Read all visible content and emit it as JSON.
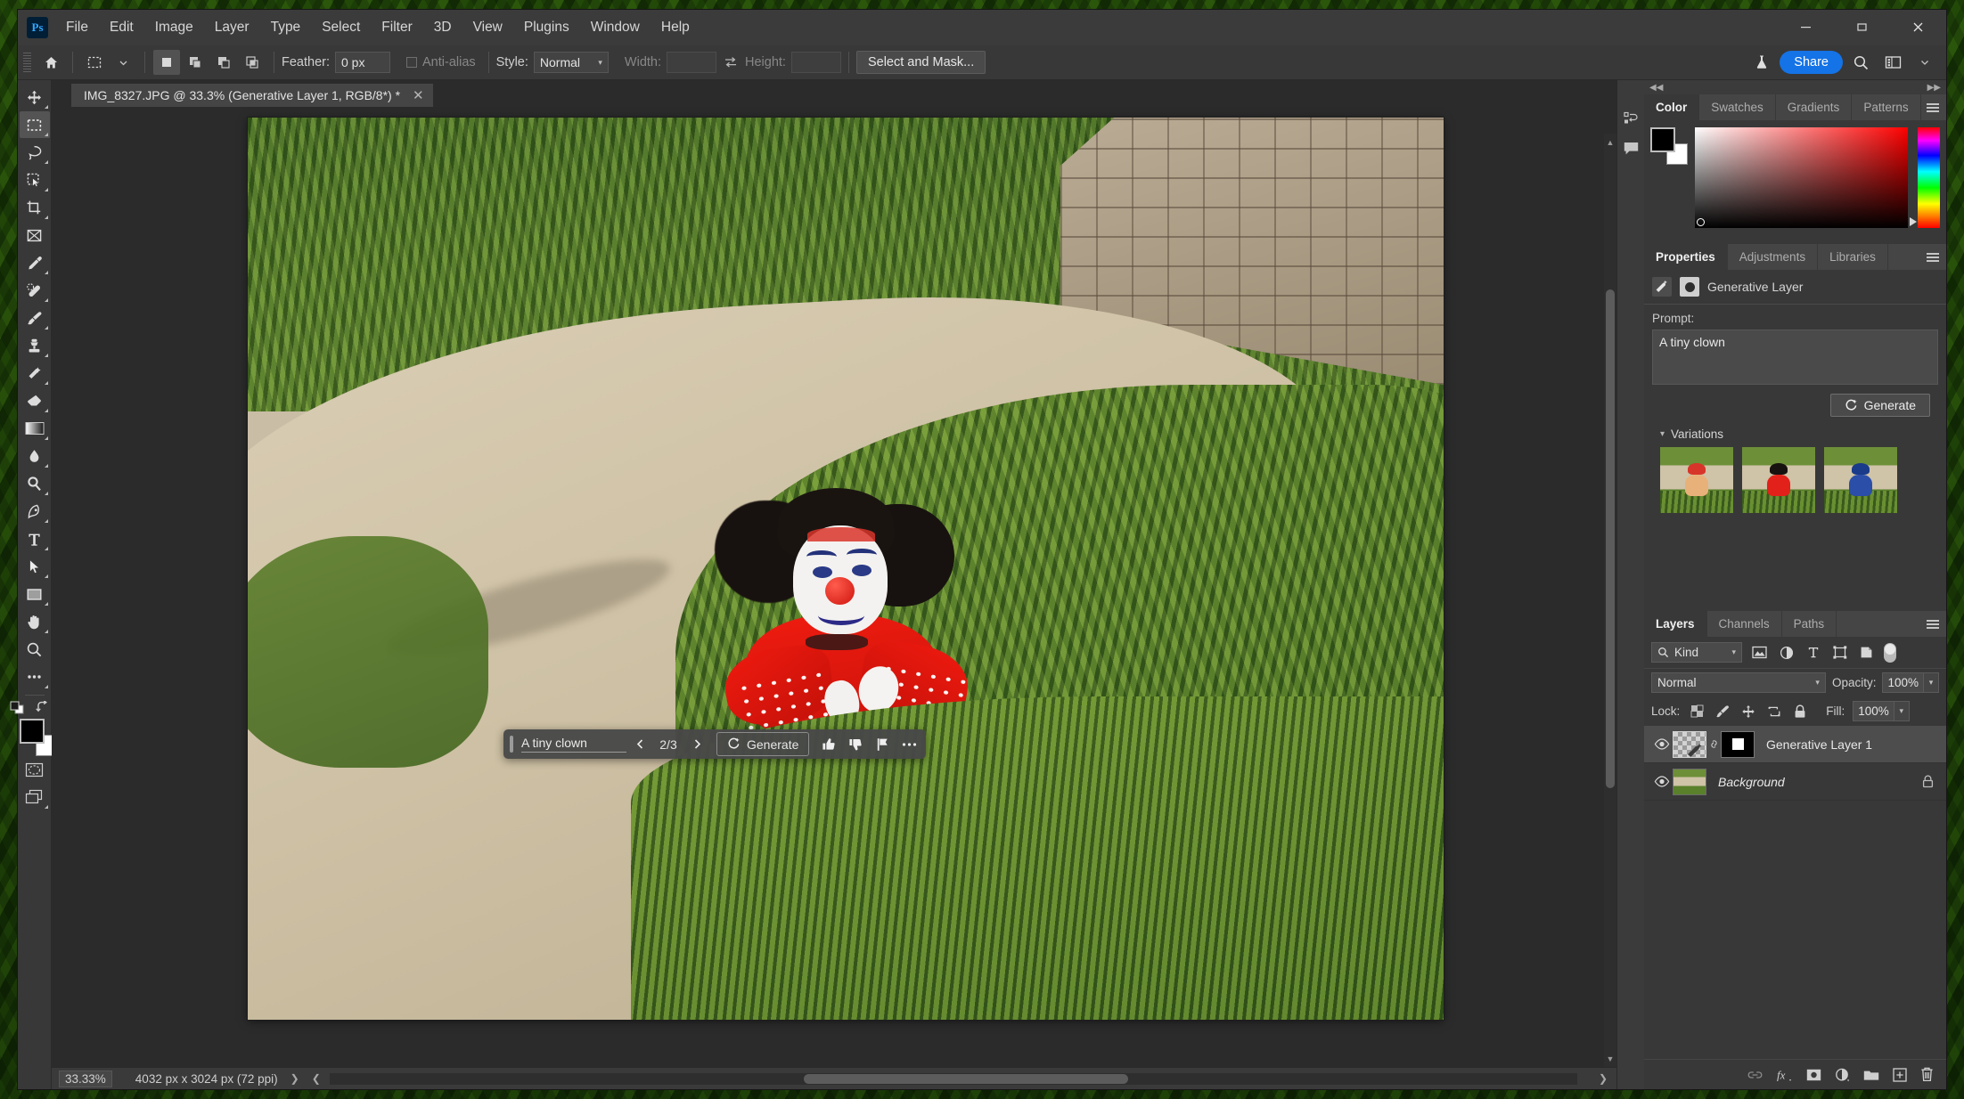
{
  "app": {
    "name": "Adobe Photoshop",
    "logo_text": "Ps"
  },
  "menu": {
    "items": [
      "File",
      "Edit",
      "Image",
      "Layer",
      "Type",
      "Select",
      "Filter",
      "3D",
      "View",
      "Plugins",
      "Window",
      "Help"
    ]
  },
  "window_controls": {
    "minimize": "minimize-button",
    "maximize": "maximize-button",
    "close": "close-button"
  },
  "options_bar": {
    "home_icon": "home-icon",
    "tool_preset": "rectangular-marquee-tool",
    "selection_modes": [
      "new-selection",
      "add-to-selection",
      "subtract-from-selection",
      "intersect-with-selection"
    ],
    "active_selection_mode": 0,
    "feather_label": "Feather:",
    "feather_value": "0 px",
    "antialias_label": "Anti-alias",
    "antialias_checked": false,
    "style_label": "Style:",
    "style_value": "Normal",
    "width_label": "Width:",
    "width_value": "",
    "swap_icon": "swap-width-height-icon",
    "height_label": "Height:",
    "height_value": "",
    "select_and_mask": "Select and Mask...",
    "flask_icon": "beta-flask-icon",
    "share_label": "Share",
    "search_icon": "search-icon",
    "workspace_icon": "workspace-switcher-icon",
    "workspace_caret": "chevron-down-icon"
  },
  "toolbar": {
    "tools": [
      {
        "name": "move-tool",
        "has_flyout": true
      },
      {
        "name": "rectangular-marquee-tool",
        "has_flyout": true,
        "active": true
      },
      {
        "name": "lasso-tool",
        "has_flyout": true
      },
      {
        "name": "object-selection-tool",
        "has_flyout": true
      },
      {
        "name": "crop-tool",
        "has_flyout": true
      },
      {
        "name": "frame-tool",
        "has_flyout": false
      },
      {
        "name": "eyedropper-tool",
        "has_flyout": true
      },
      {
        "name": "spot-healing-brush-tool",
        "has_flyout": true
      },
      {
        "name": "brush-tool",
        "has_flyout": true
      },
      {
        "name": "clone-stamp-tool",
        "has_flyout": true
      },
      {
        "name": "history-brush-tool",
        "has_flyout": true
      },
      {
        "name": "eraser-tool",
        "has_flyout": true
      },
      {
        "name": "gradient-tool",
        "has_flyout": true
      },
      {
        "name": "blur-tool",
        "has_flyout": true
      },
      {
        "name": "dodge-tool",
        "has_flyout": true
      },
      {
        "name": "pen-tool",
        "has_flyout": true
      },
      {
        "name": "type-tool",
        "has_flyout": true
      },
      {
        "name": "path-selection-tool",
        "has_flyout": true
      },
      {
        "name": "rectangle-tool",
        "has_flyout": true
      },
      {
        "name": "hand-tool",
        "has_flyout": true
      },
      {
        "name": "zoom-tool",
        "has_flyout": false
      },
      {
        "name": "edit-toolbar-ellipsis",
        "has_flyout": true
      }
    ],
    "default_colors_icon": "default-foreground-background-icon",
    "swap_colors_icon": "swap-foreground-background-icon",
    "foreground_color": "#000000",
    "background_color": "#ffffff",
    "quick_mask_icon": "quick-mask-mode-icon",
    "screen_mode_icon": "screen-mode-icon"
  },
  "document": {
    "tab_title": "IMG_8327.JPG @ 33.3% (Generative Layer 1, RGB/8*) *",
    "close_icon": "close-tab-icon"
  },
  "contextual_taskbar": {
    "grip_icon": "drag-handle-icon",
    "prompt_text": "A tiny clown",
    "prev_icon": "chevron-left-icon",
    "variation_count": "2/3",
    "next_icon": "chevron-right-icon",
    "generate_label": "Generate",
    "generate_icon": "generative-fill-icon",
    "thumbs_up_icon": "thumbs-up-icon",
    "thumbs_down_icon": "thumbs-down-icon",
    "report_icon": "flag-report-icon",
    "more_icon": "more-options-icon",
    "collapse_icon": "collapse-caret-icon"
  },
  "status_bar": {
    "zoom_level": "33.33%",
    "doc_dimensions": "4032 px x 3024 px (72 ppi)",
    "expand_icon": "chevron-right-icon",
    "prev_icon": "chevron-left-icon",
    "next_icon": "chevron-right-icon"
  },
  "dock": {
    "rail_icons": [
      "history-panel-icon",
      "comments-panel-icon"
    ],
    "collapse_left_icon": "collapse-panels-icon",
    "expand_right_icon": "expand-panels-icon"
  },
  "color_panel": {
    "tabs": [
      "Color",
      "Swatches",
      "Gradients",
      "Patterns"
    ],
    "active_tab": "Color",
    "menu_icon": "panel-menu-icon",
    "foreground_color": "#000000",
    "background_color": "#ffffff",
    "hue": "#ff0000"
  },
  "properties_panel": {
    "tabs": [
      "Properties",
      "Adjustments",
      "Libraries"
    ],
    "active_tab": "Properties",
    "menu_icon": "panel-menu-icon",
    "layer_type_icon": "generative-layer-icon",
    "mask_icon": "layer-mask-icon",
    "layer_type_label": "Generative Layer",
    "prompt_label": "Prompt:",
    "prompt_value": "A tiny clown",
    "generate_label": "Generate",
    "generate_icon": "generative-fill-icon",
    "variations_label": "Variations",
    "variations_twisty": "chevron-down-icon",
    "variations": [
      {
        "name": "variation-1",
        "selected": false,
        "hair": "#d8352a",
        "body": "#e8b17a"
      },
      {
        "name": "variation-2",
        "selected": true,
        "hair": "#17120f",
        "body": "#e2211a"
      },
      {
        "name": "variation-3",
        "selected": false,
        "hair": "#1a3a8a",
        "body": "#2b4ea8"
      }
    ],
    "selected_variation_index": 1,
    "selection_color": "#1473e6"
  },
  "layers_panel": {
    "tabs": [
      "Layers",
      "Channels",
      "Paths"
    ],
    "active_tab": "Layers",
    "menu_icon": "panel-menu-icon",
    "filter_label": "Kind",
    "filter_icon": "search-icon",
    "filter_caret": "chevron-down-icon",
    "filter_type_icons": [
      "filter-pixel-icon",
      "filter-adjustment-icon",
      "filter-type-icon",
      "filter-shape-icon",
      "filter-smart-object-icon"
    ],
    "filter_toggle": "filter-enable-toggle",
    "blend_mode": "Normal",
    "blend_caret": "chevron-down-icon",
    "opacity_label": "Opacity:",
    "opacity_value": "100%",
    "opacity_caret": "chevron-down-icon",
    "lock_label": "Lock:",
    "lock_icons": [
      "lock-transparent-pixels-icon",
      "lock-image-pixels-icon",
      "lock-position-icon",
      "lock-artboard-nesting-icon",
      "lock-all-icon"
    ],
    "fill_label": "Fill:",
    "fill_value": "100%",
    "fill_caret": "chevron-down-icon",
    "layers": [
      {
        "name": "Generative Layer 1",
        "visible": true,
        "selected": true,
        "italic": false,
        "has_mask": true,
        "linked": true,
        "locked": false,
        "thumb_type": "checker-generative"
      },
      {
        "name": "Background",
        "visible": true,
        "selected": false,
        "italic": true,
        "has_mask": false,
        "linked": false,
        "locked": true,
        "thumb_type": "photo"
      }
    ],
    "footer_icons": [
      "link-layers-icon",
      "layer-style-fx-icon",
      "add-layer-mask-icon",
      "new-adjustment-layer-icon",
      "new-group-icon",
      "new-layer-icon",
      "delete-layer-icon"
    ]
  },
  "canvas": {
    "scene_description": "clown-doll-on-path-with-grass",
    "zoom": "33.3%"
  }
}
